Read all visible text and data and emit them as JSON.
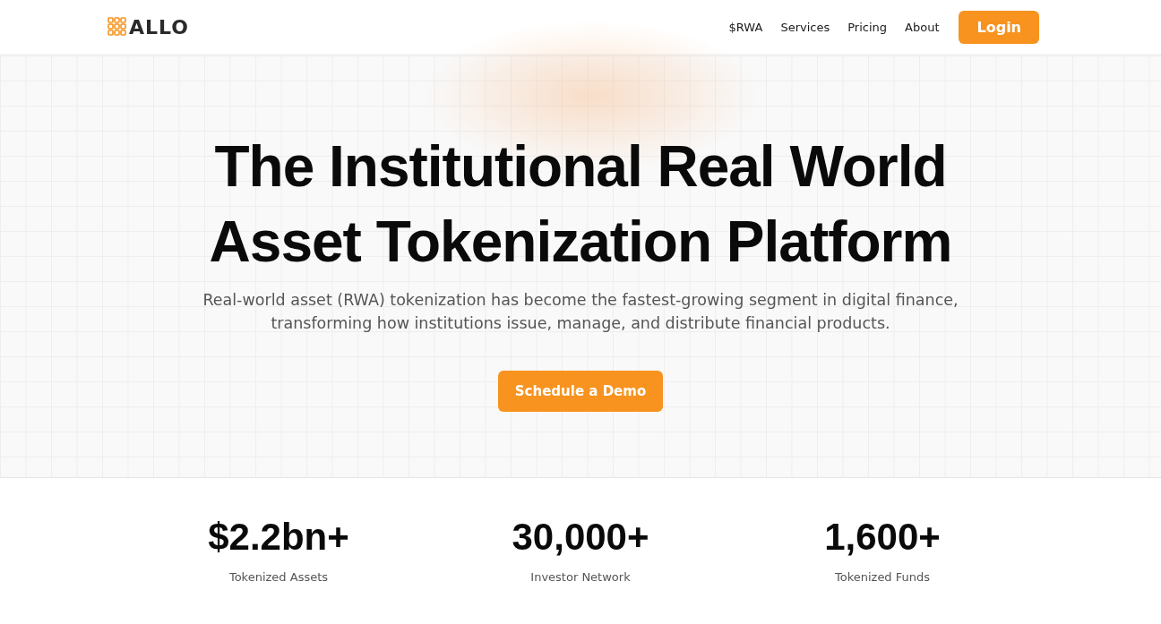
{
  "header": {
    "logo": "ALLO",
    "nav": [
      "$RWA",
      "Services",
      "Pricing",
      "About"
    ],
    "login": "Login"
  },
  "hero": {
    "title_lines": [
      "The Institutional Real World",
      "Asset Tokenization Platform"
    ],
    "subtitle": "Real-world asset (RWA) tokenization has become the fastest-growing segment in digital finance, transforming how institutions issue, manage, and distribute financial products.",
    "cta": "Schedule a Demo"
  },
  "stats": [
    {
      "value": "$2.2bn+",
      "label": "Tokenized Assets"
    },
    {
      "value": "30,000+",
      "label": "Investor Network"
    },
    {
      "value": "1,600+",
      "label": "Tokenized Funds"
    }
  ]
}
